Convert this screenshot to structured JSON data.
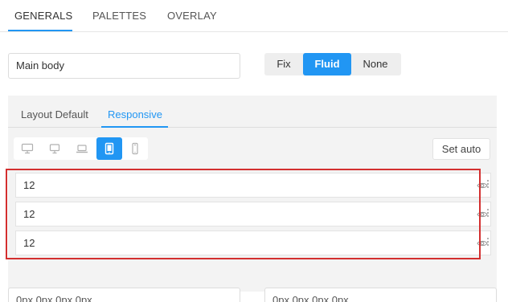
{
  "top_tabs": {
    "generals": "GENERALS",
    "palettes": "PALETTES",
    "overlay": "OVERLAY"
  },
  "main_body_input": {
    "value": "Main body"
  },
  "width_mode": {
    "options": [
      "Fix",
      "Fluid",
      "None"
    ],
    "selected": "Fluid"
  },
  "panel": {
    "tabs": {
      "layout_default": "Layout Default",
      "responsive": "Responsive"
    },
    "active_tab": "Responsive",
    "devices": [
      "desktop-large-icon",
      "desktop-icon",
      "laptop-icon",
      "tablet-icon",
      "mobile-icon"
    ],
    "active_device": "tablet-icon",
    "set_auto_label": "Set auto",
    "rows": [
      {
        "value": "12"
      },
      {
        "value": "12"
      },
      {
        "value": "12"
      }
    ]
  },
  "bottom_inputs": {
    "left": "0px 0px 0px 0px",
    "right": "0px 0px 0px 0px"
  },
  "colors": {
    "accent": "#2196f3",
    "highlight": "#d32f2f",
    "panel_bg": "#f3f3f3"
  }
}
